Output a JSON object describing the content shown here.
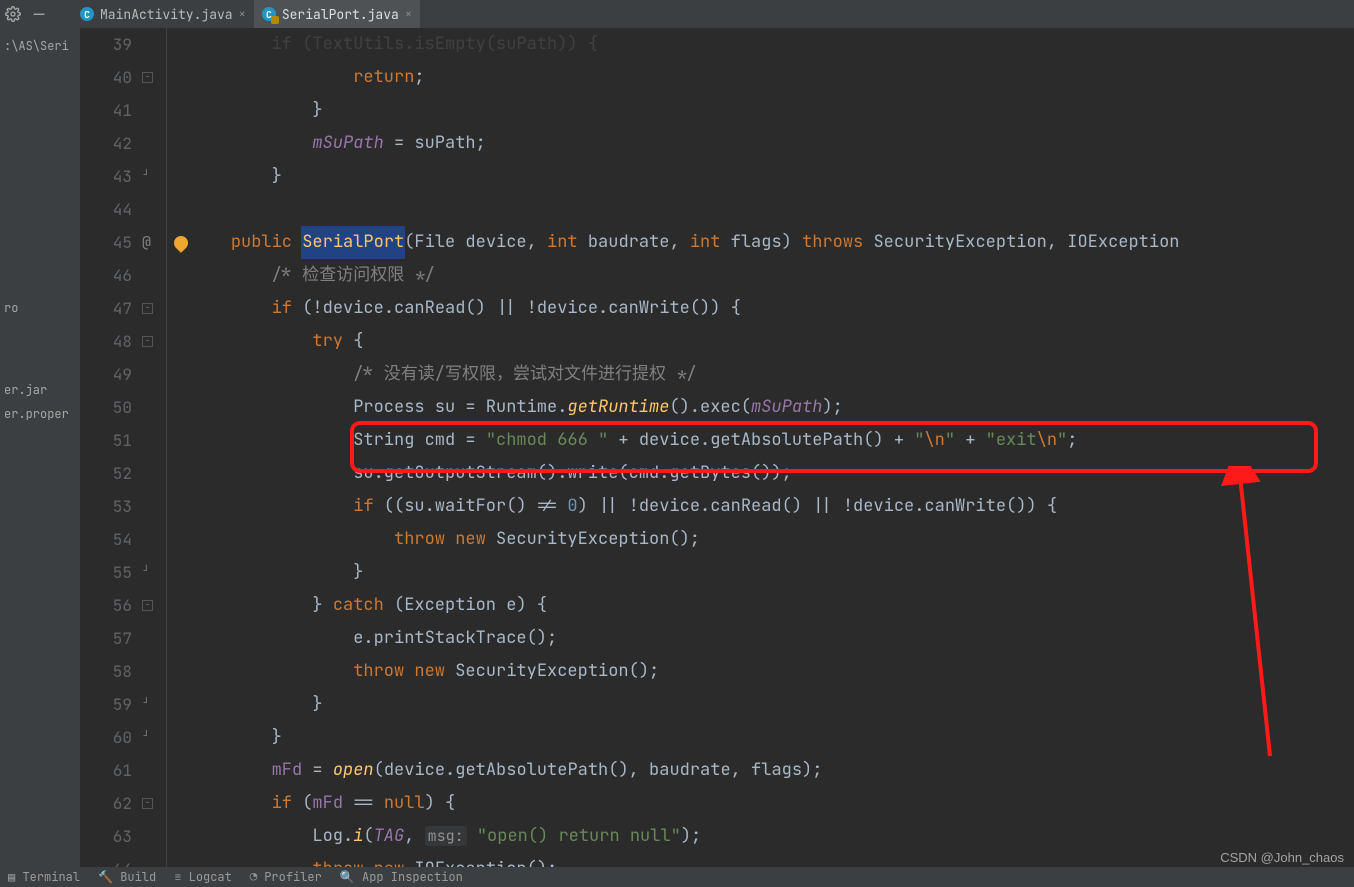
{
  "tabs": [
    {
      "label": "MainActivity.java",
      "active": false,
      "locked": false
    },
    {
      "label": "SerialPort.java",
      "active": true,
      "locked": true
    }
  ],
  "leftRail": {
    "path1": ":\\AS\\Seri",
    "path2": "ro",
    "path3": "er.jar",
    "path4": "er.proper"
  },
  "gutter": {
    "start": 39,
    "end": 64,
    "atLine": 45,
    "bulbLine": 45,
    "foldOpenLines": [
      40,
      47,
      48,
      56,
      62
    ],
    "foldMinusLines": [
      43,
      55,
      59,
      60
    ]
  },
  "code": {
    "l39": {
      "pre": "        if (TextUtils.isEmpty(suPath)) {"
    },
    "l40": {
      "pre": "                ",
      "kw": "return",
      "tail": ";"
    },
    "l41": {
      "pre": "            }"
    },
    "l42": {
      "pre": "            ",
      "f": "mSuPath",
      "mid": " = suPath;"
    },
    "l43": {
      "pre": "        }"
    },
    "l44": {
      "pre": ""
    },
    "l45": {
      "pre": "    ",
      "kw1": "public",
      "sp": " ",
      "name": "SerialPort",
      "open": "(",
      "t1": "File device",
      "c1": ", ",
      "kw2": "int",
      "a2": " baudrate",
      "c2": ", ",
      "kw3": "int",
      "a3": " flags) ",
      "kw4": "throws",
      "rest": " SecurityException, IOException"
    },
    "l46": {
      "pre": "        ",
      "cmt": "/* 检查访问权限 */"
    },
    "l47": {
      "pre": "        ",
      "kw": "if",
      "cond": " (!device.canRead() || !device.canWrite()) {"
    },
    "l48": {
      "pre": "            ",
      "kw": "try",
      "tail": " {"
    },
    "l49": {
      "pre": "                ",
      "cmt": "/* 没有读/写权限，尝试对文件进行提权 */"
    },
    "l50": {
      "pre": "                Process su = Runtime.",
      "mth": "getRuntime",
      "mid": "().exec(",
      "f": "mSuPath",
      "tail": ");"
    },
    "l51": {
      "pre": "                String cmd = ",
      "s1": "\"chmod 666 \"",
      "p1": " + device.getAbsolutePath() + ",
      "s2a": "\"",
      "s2e": "\\n",
      "s2b": "\"",
      "p2": " + ",
      "s3a": "\"exit",
      "s3e": "\\n",
      "s3b": "\"",
      "tail": ";"
    },
    "l52": {
      "pre": "                su.getOutputStream().write(cmd.getBytes());"
    },
    "l53": {
      "pre": "                ",
      "kw": "if",
      "open": " ((su.waitFor() != ",
      "n": "0",
      "rest": ") || !device.canRead() || !device.canWrite()) {"
    },
    "l54": {
      "pre": "                    ",
      "kw1": "throw",
      "sp": " ",
      "kw2": "new",
      "rest": " SecurityException();"
    },
    "l55": {
      "pre": "                }"
    },
    "l56": {
      "pre": "            } ",
      "kw": "catch",
      "rest": " (Exception e) {"
    },
    "l57": {
      "pre": "                e.printStackTrace();"
    },
    "l58": {
      "pre": "                ",
      "kw1": "throw",
      "sp": " ",
      "kw2": "new",
      "rest": " SecurityException();"
    },
    "l59": {
      "pre": "            }"
    },
    "l60": {
      "pre": "        }"
    },
    "l61": {
      "pre": "        ",
      "f": "mFd",
      "mid": " = ",
      "mth": "open",
      "rest": "(device.getAbsolutePath(), baudrate, flags);"
    },
    "l62": {
      "pre": "        ",
      "kw": "if",
      "open": " (",
      "f": "mFd",
      "mid": " == ",
      "kw2": "null",
      "rest": ") {"
    },
    "l63": {
      "pre": "            Log.",
      "mth": "i",
      "open": "(",
      "f": "TAG",
      "c": ", ",
      "param": "msg:",
      "sp": " ",
      "s": "\"open() return null\"",
      "rest": ");"
    },
    "l64": {
      "pre": "            ",
      "kw1": "throw",
      "sp": " ",
      "kw2": "new",
      "rest": " IOException();"
    }
  },
  "status": {
    "items": [
      "Terminal",
      "Build",
      "Logcat",
      "Profiler",
      "App Inspection"
    ]
  },
  "watermark": "CSDN @John_chaos"
}
